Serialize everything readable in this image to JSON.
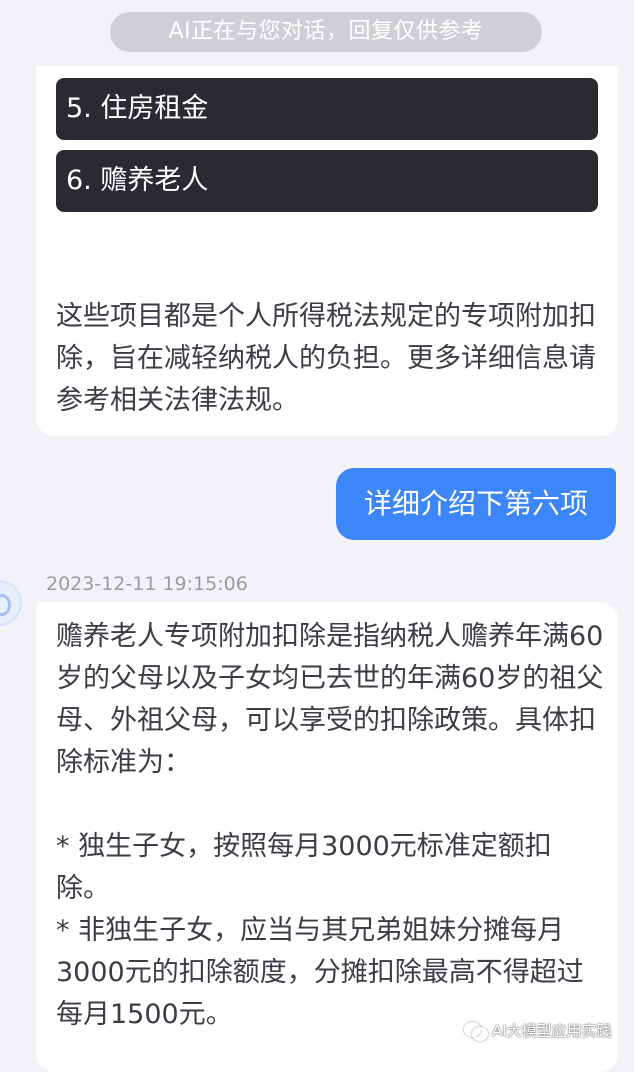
{
  "notice": "AI正在与您对话，回复仅供参考",
  "prev_reply": {
    "list_items": [
      "5. 住房租金",
      "6. 赡养老人"
    ],
    "summary": "这些项目都是个人所得税法规定的专项附加扣除，旨在减轻纳税人的负担。更多详细信息请参考相关法律法规。"
  },
  "user_message": "详细介绍下第六项",
  "reply": {
    "timestamp": "2023-12-11 19:15:06",
    "text": "赡养老人专项附加扣除是指纳税人赡养年满60岁的父母以及子女均已去世的年满60岁的祖父母、外祖父母，可以享受的扣除政策。具体扣除标准为：\n\n* 独生子女，按照每月3000元标准定额扣除。\n* 非独生子女，应当与其兄弟姐妹分摊每月3000元的扣除额度，分摊扣除最高不得超过每月1500元。"
  },
  "watermark": "AI大模型应用实践",
  "colors": {
    "user_bubble": "#3c86f7",
    "list_row_bg": "#292b31",
    "page_bg": "#f2f3f7"
  }
}
